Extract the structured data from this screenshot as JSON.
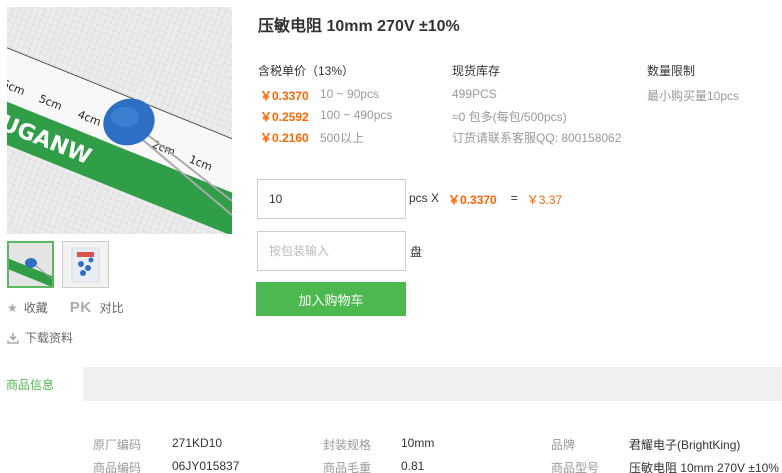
{
  "product": {
    "title": "压敏电阻 10mm 270V ±10%",
    "image_brand_text": "YOUGANW"
  },
  "headers": {
    "price": "含税单价（13%）",
    "stock": "现货库存",
    "limit": "数量限制"
  },
  "prices": [
    {
      "price": "￥0.3370",
      "range": "10 ~ 90pcs"
    },
    {
      "price": "￥0.2592",
      "range": "100 ~ 490pcs"
    },
    {
      "price": "￥0.2160",
      "range": "500以上"
    }
  ],
  "stock": {
    "qty": "499PCS",
    "package": "≈0 包多(每包/500pcs)",
    "contact": "订货请联系客服QQ: 800158062"
  },
  "limit": {
    "text": "最小购买量10pcs"
  },
  "order": {
    "qty_value": "10",
    "unit_x": "pcs X",
    "unit_price": "￥0.3370",
    "equals": "=",
    "total": "￥3.37",
    "package_placeholder": "按包装输入",
    "package_unit": "盘",
    "cart_label": "加入购物车"
  },
  "actions": {
    "favorite": "收藏",
    "pk": "PK",
    "compare": "对比",
    "download": "下载资料"
  },
  "tabs": {
    "info": "商品信息"
  },
  "specs": {
    "row1": [
      {
        "label": "原厂编码",
        "value": "271KD10"
      },
      {
        "label": "封装规格",
        "value": "10mm"
      },
      {
        "label": "品牌",
        "value": "君耀电子(BrightKing)"
      }
    ],
    "row2": [
      {
        "label": "商品编码",
        "value": "06JY015837"
      },
      {
        "label": "商品毛重",
        "value": "0.81"
      },
      {
        "label": "商品型号",
        "value": "压敏电阻 10mm 270V ±10%"
      }
    ]
  },
  "colors": {
    "accent_green": "#4cb84f",
    "price_orange": "#ff6600"
  }
}
